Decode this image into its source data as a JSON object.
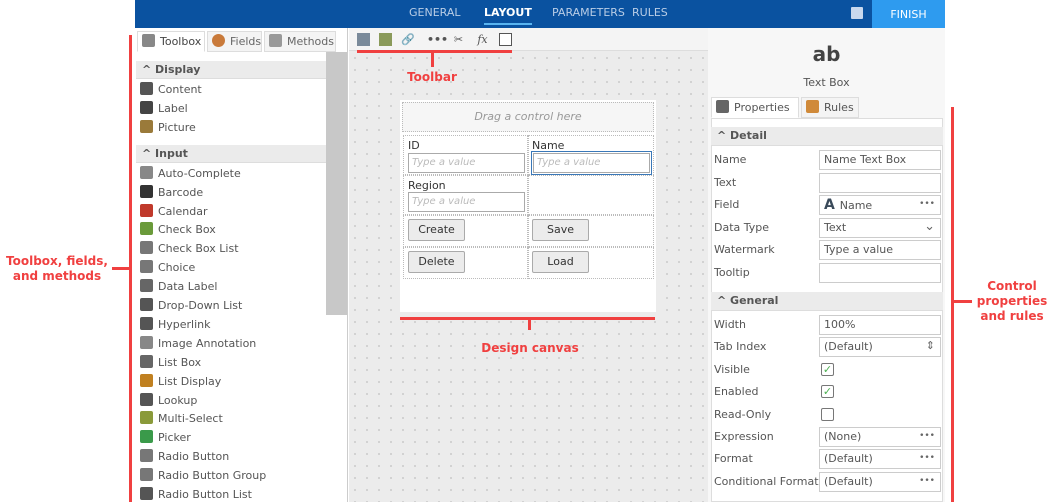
{
  "nav": {
    "tabs": [
      "GENERAL",
      "LAYOUT",
      "PARAMETERS",
      "RULES"
    ],
    "active": "LAYOUT",
    "finish": "FINISH"
  },
  "left": {
    "tabs": [
      "Toolbox",
      "Fields",
      "Methods"
    ],
    "sections": [
      {
        "title": "Display",
        "items": [
          "Content",
          "Label",
          "Picture"
        ]
      },
      {
        "title": "Input",
        "items": [
          "Auto-Complete",
          "Barcode",
          "Calendar",
          "Check Box",
          "Check Box List",
          "Choice",
          "Data Label",
          "Drop-Down List",
          "Hyperlink",
          "Image Annotation",
          "List Box",
          "List Display",
          "Lookup",
          "Multi-Select",
          "Picker",
          "Radio Button",
          "Radio Button Group",
          "Radio Button List"
        ]
      }
    ]
  },
  "form": {
    "drop_hint": "Drag a control here",
    "id_label": "ID",
    "name_label": "Name",
    "region_label": "Region",
    "placeholder": "Type a value",
    "buttons": [
      "Create",
      "Save",
      "Delete",
      "Load"
    ]
  },
  "right": {
    "control_icon": "ab",
    "control_name": "Text Box",
    "tabs": [
      "Properties",
      "Rules"
    ],
    "detail": {
      "title": "Detail",
      "rows": [
        {
          "label": "Name",
          "value": "Name Text Box"
        },
        {
          "label": "Text",
          "value": ""
        },
        {
          "label": "Field",
          "value": "Name"
        },
        {
          "label": "Data Type",
          "value": "Text"
        },
        {
          "label": "Watermark",
          "value": "Type a value"
        },
        {
          "label": "Tooltip",
          "value": ""
        }
      ]
    },
    "general": {
      "title": "General",
      "rows": [
        {
          "label": "Width",
          "value": "100%"
        },
        {
          "label": "Tab Index",
          "value": "(Default)"
        },
        {
          "label": "Visible",
          "checked": true
        },
        {
          "label": "Enabled",
          "checked": true
        },
        {
          "label": "Read-Only",
          "checked": false
        },
        {
          "label": "Expression",
          "value": "(None)"
        },
        {
          "label": "Format",
          "value": "(Default)"
        },
        {
          "label": "Conditional Format",
          "value": "(Default)"
        }
      ]
    }
  },
  "annotations": {
    "toolbar": "Toolbar",
    "canvas": "Design canvas",
    "left": "Toolbox, fields, and methods",
    "right": "Control properties and rules"
  },
  "colors": {
    "topbar": "#0a52a0",
    "finish": "#2e9bef",
    "annotation": "#f04040"
  }
}
